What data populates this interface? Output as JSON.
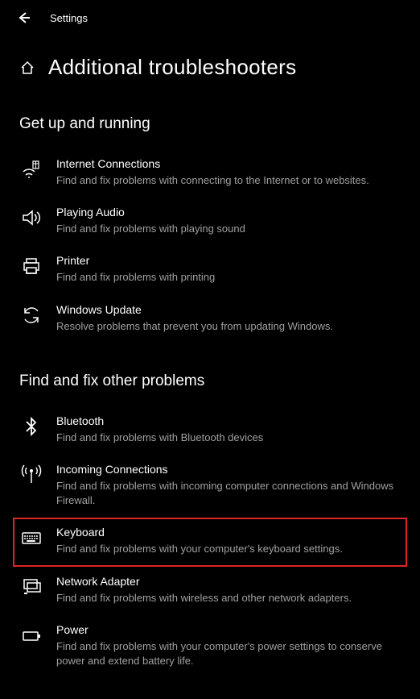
{
  "header": {
    "app_name": "Settings"
  },
  "page": {
    "title": "Additional troubleshooters"
  },
  "sections": {
    "s1": {
      "title": "Get up and running",
      "items": {
        "internet": {
          "title": "Internet Connections",
          "desc": "Find and fix problems with connecting to the Internet or to websites."
        },
        "audio": {
          "title": "Playing Audio",
          "desc": "Find and fix problems with playing sound"
        },
        "printer": {
          "title": "Printer",
          "desc": "Find and fix problems with printing"
        },
        "update": {
          "title": "Windows Update",
          "desc": "Resolve problems that prevent you from updating Windows."
        }
      }
    },
    "s2": {
      "title": "Find and fix other problems",
      "items": {
        "bluetooth": {
          "title": "Bluetooth",
          "desc": "Find and fix problems with Bluetooth devices"
        },
        "incoming": {
          "title": "Incoming Connections",
          "desc": "Find and fix problems with incoming computer connections and Windows Firewall."
        },
        "keyboard": {
          "title": "Keyboard",
          "desc": "Find and fix problems with your computer's keyboard settings."
        },
        "network": {
          "title": "Network Adapter",
          "desc": "Find and fix problems with wireless and other network adapters."
        },
        "power": {
          "title": "Power",
          "desc": "Find and fix problems with your computer's power settings to conserve power and extend battery life."
        }
      }
    }
  }
}
